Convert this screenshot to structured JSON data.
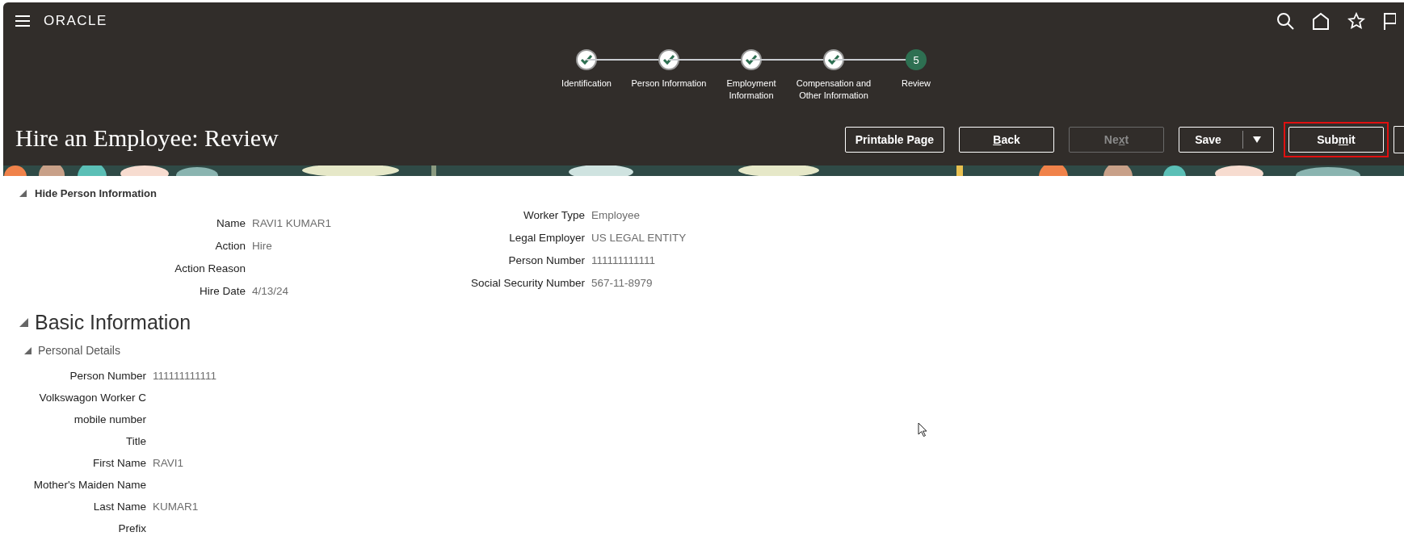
{
  "header": {
    "logo": "ORACLE"
  },
  "steps": [
    {
      "label": "Identification",
      "kind": "done"
    },
    {
      "label": "Person Information",
      "kind": "done"
    },
    {
      "label": "Employment Information",
      "kind": "done"
    },
    {
      "label": "Compensation and Other Information",
      "kind": "done"
    },
    {
      "label": "Review",
      "kind": "current",
      "number": "5"
    }
  ],
  "page_title": "Hire an Employee: Review",
  "buttons": [
    {
      "label": {
        "before": "Printable Page"
      },
      "disabled": false,
      "highlighted": false,
      "kind": "plain"
    },
    {
      "label": {
        "key": "B",
        "after": "ack"
      },
      "disabled": false,
      "highlighted": false,
      "kind": "plain"
    },
    {
      "label": {
        "before": "Ne",
        "key": "x",
        "after": "t"
      },
      "disabled": true,
      "highlighted": false,
      "kind": "plain"
    },
    {
      "label": {
        "before": "Save"
      },
      "disabled": false,
      "highlighted": false,
      "kind": "split"
    },
    {
      "label": {
        "before": "Sub",
        "key": "m",
        "after": "it"
      },
      "disabled": false,
      "highlighted": true,
      "kind": "plain"
    }
  ],
  "person_section": {
    "toggle": "Hide Person Information",
    "left": [
      {
        "label": "Name",
        "value": "RAVI1 KUMAR1"
      },
      {
        "label": "Action",
        "value": "Hire"
      },
      {
        "label": "Action Reason"
      },
      {
        "label": "Hire Date",
        "value": "4/13/24"
      }
    ],
    "right": [
      {
        "label": "Worker Type",
        "value": "Employee"
      },
      {
        "label": "Legal Employer",
        "value": "US LEGAL ENTITY"
      },
      {
        "label": "Person Number",
        "value": "111111111111"
      },
      {
        "label": "Social Security Number",
        "value": "567-11-8979"
      }
    ]
  },
  "basic_information": {
    "title": "Basic Information",
    "subsection": "Personal Details",
    "fields": [
      {
        "label": "Person Number",
        "value": "111111111111"
      },
      {
        "label": "Volkswagon Worker C"
      },
      {
        "label": "mobile number"
      },
      {
        "label": "Title"
      },
      {
        "label": "First Name",
        "value": "RAVI1"
      },
      {
        "label": "Mother's Maiden Name"
      },
      {
        "label": "Last Name",
        "value": "KUMAR1"
      },
      {
        "label": "Prefix"
      }
    ]
  }
}
